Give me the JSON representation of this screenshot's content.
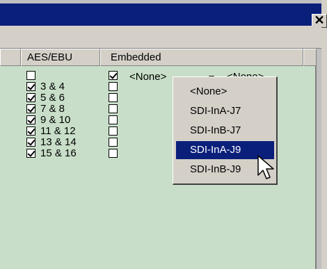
{
  "window": {
    "close_label": "✕"
  },
  "columns": {
    "aes_ebu": "AES/EBU",
    "embedded": "Embedded"
  },
  "aes_rows": [
    {
      "label": "",
      "checked": false
    },
    {
      "label": "3 & 4",
      "checked": true
    },
    {
      "label": "5 & 6",
      "checked": true
    },
    {
      "label": "7 & 8",
      "checked": true
    },
    {
      "label": "9 & 10",
      "checked": true
    },
    {
      "label": "11 & 12",
      "checked": true
    },
    {
      "label": "13 & 14",
      "checked": true
    },
    {
      "label": "15 & 16",
      "checked": true
    }
  ],
  "embedded_rows": [
    {
      "checked": true
    },
    {
      "checked": false
    },
    {
      "checked": false
    },
    {
      "checked": false
    },
    {
      "checked": false
    },
    {
      "checked": false
    },
    {
      "checked": false
    },
    {
      "checked": false
    }
  ],
  "combo": {
    "value": "<None>",
    "second_value": "<None>"
  },
  "dropdown": {
    "items": [
      "<None>",
      "SDI-InA-J7",
      "SDI-InB-J7",
      "SDI-InA-J9",
      "SDI-InB-J9"
    ],
    "selected_index": 3
  },
  "colors": {
    "title_bar": "#0a1f7a",
    "list_background": "#c8dec8",
    "selection": "#0a1f7a"
  }
}
